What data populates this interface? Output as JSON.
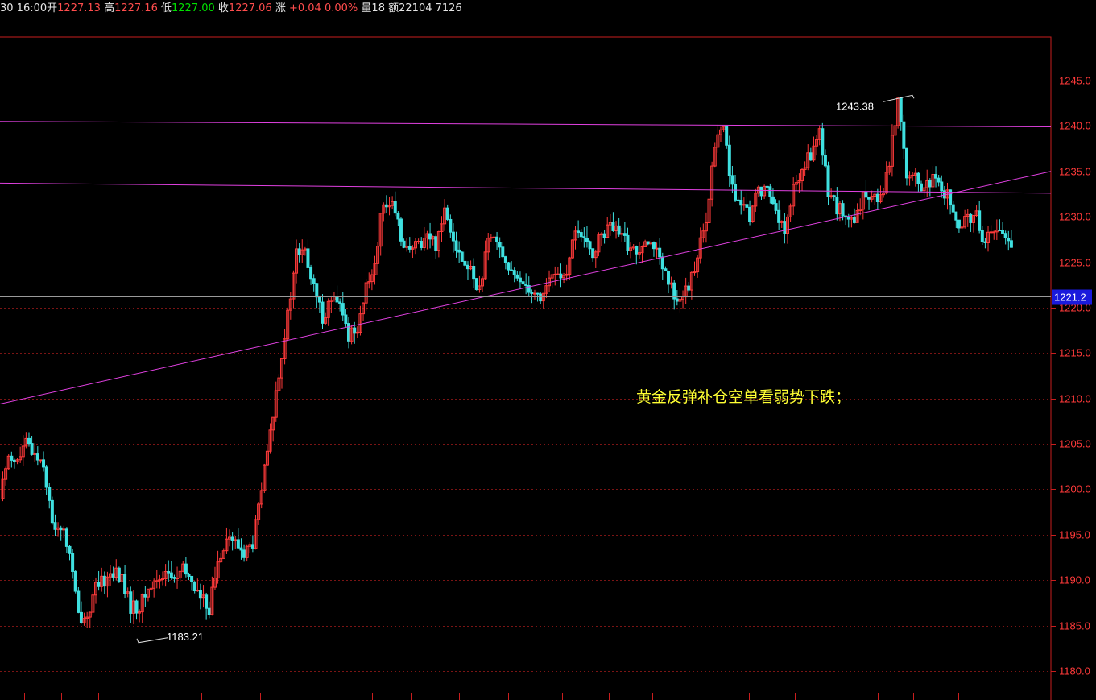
{
  "header": {
    "time_prefix": "30 16:00",
    "open_label": "开",
    "open": "1227.13",
    "high_label": "高",
    "high": "1227.16",
    "low_label": "低",
    "low": "1227.00",
    "close_label": "收",
    "close": "1227.06",
    "change_label": "涨",
    "change": "+0.04 0.00%",
    "volume_label": "量",
    "volume": "18",
    "amount_label": "额",
    "amount": "22104 7126"
  },
  "annotation": "黄金反弹补仓空单看弱势下跌；",
  "chart_data": {
    "type": "candlestick",
    "title": "",
    "xlabel": "",
    "ylabel": "",
    "ylim": [
      1178.0,
      1248.5
    ],
    "y_ticks": [
      "1245.0",
      "1240.0",
      "1235.0",
      "1230.0",
      "1225.0",
      "1220.0",
      "1215.0",
      "1210.0",
      "1205.0",
      "1200.0",
      "1195.0",
      "1190.0",
      "1185.0",
      "1180.0"
    ],
    "current_price": "1221.2",
    "current_price_value": 1221.2,
    "grid": true,
    "labels": [
      {
        "text": "1243.38",
        "value": 1243.38,
        "kind": "high"
      },
      {
        "text": "1183.21",
        "value": 1183.21,
        "kind": "low"
      }
    ],
    "trendlines": [
      {
        "name": "upper-resistance",
        "color": "#e040e0",
        "from": 1240.5,
        "to": 1239.9
      },
      {
        "name": "middle-resistance",
        "color": "#e040e0",
        "from": 1233.7,
        "to": 1232.6
      },
      {
        "name": "rising-support",
        "color": "#e040e0",
        "from": 1209.4,
        "to": 1235.0
      }
    ],
    "close_path": [
      1199,
      1204,
      1203,
      1205,
      1204,
      1203,
      1196,
      1196,
      1193,
      1186,
      1186,
      1189,
      1190,
      1191,
      1190,
      1187,
      1187,
      1189,
      1190,
      1191,
      1190,
      1191,
      1190,
      1188,
      1187,
      1192,
      1195,
      1194,
      1193,
      1194,
      1200,
      1206,
      1213,
      1219,
      1226,
      1226,
      1222,
      1219,
      1221,
      1220,
      1217,
      1218,
      1222,
      1225,
      1232,
      1231,
      1228,
      1226,
      1227,
      1228,
      1227,
      1231,
      1228,
      1225,
      1224,
      1222,
      1227,
      1228,
      1225,
      1223,
      1223,
      1222,
      1221,
      1223,
      1224,
      1223,
      1229,
      1227,
      1226,
      1228,
      1229,
      1228,
      1227,
      1226,
      1228,
      1227,
      1224,
      1222,
      1221,
      1222,
      1226,
      1229,
      1238,
      1240,
      1233,
      1231,
      1230,
      1233,
      1233,
      1231,
      1228,
      1233,
      1235,
      1237,
      1239,
      1233,
      1231,
      1230,
      1229,
      1232,
      1233,
      1232,
      1236,
      1243,
      1235,
      1234,
      1233,
      1234,
      1233,
      1232,
      1228,
      1230,
      1230,
      1227,
      1229,
      1228,
      1227
    ],
    "candle_colors": {
      "up": "#ff3a3a",
      "down": "#3fe0e0",
      "line": "#e040e0",
      "axis": "#c81e1e"
    }
  }
}
